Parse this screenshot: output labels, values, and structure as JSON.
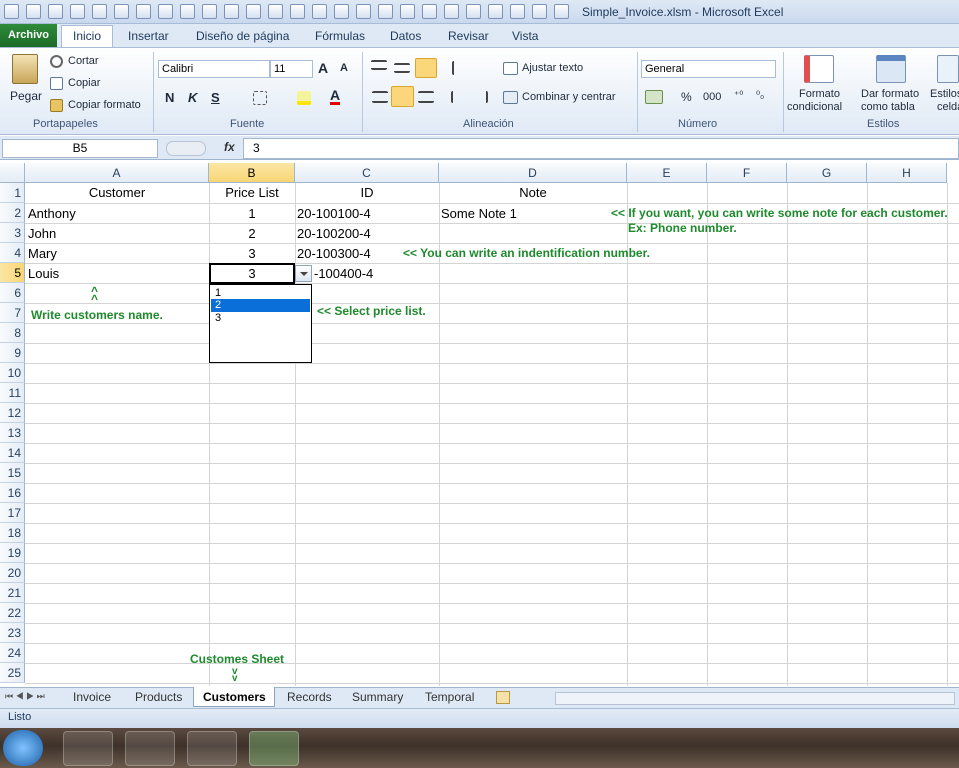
{
  "window": {
    "title": "Simple_Invoice.xlsm  -  Microsoft Excel"
  },
  "tabs": {
    "file": "Archivo",
    "items": [
      "Inicio",
      "Insertar",
      "Diseño de página",
      "Fórmulas",
      "Datos",
      "Revisar",
      "Vista"
    ]
  },
  "ribbon": {
    "clipboard": {
      "paste": "Pegar",
      "cut": "Cortar",
      "copy": "Copiar",
      "format_painter": "Copiar formato",
      "label": "Portapapeles"
    },
    "font": {
      "name": "Calibri",
      "size": "11",
      "bold": "N",
      "italic": "K",
      "underline": "S",
      "label": "Fuente"
    },
    "alignment": {
      "wrap": "Ajustar texto",
      "merge": "Combinar y centrar",
      "label": "Alineación"
    },
    "number": {
      "format": "General",
      "percent": "%",
      "thousands": "000",
      "label": "Número"
    },
    "styles": {
      "conditional_1": "Formato",
      "conditional_2": "condicional",
      "table_1": "Dar formato",
      "table_2": "como tabla",
      "cell_1": "Estilos",
      "cell_2": "celda",
      "label": "Estilos"
    }
  },
  "formula_bar": {
    "name_box": "B5",
    "fx": "fx",
    "value": "3"
  },
  "columns": [
    "A",
    "B",
    "C",
    "D",
    "E",
    "F",
    "G",
    "H"
  ],
  "rows": [
    "1",
    "2",
    "3",
    "4",
    "5",
    "6",
    "7",
    "8",
    "9",
    "10",
    "11",
    "12",
    "13",
    "14",
    "15",
    "16",
    "17",
    "18",
    "19",
    "20",
    "21",
    "22",
    "23",
    "24",
    "25"
  ],
  "cells": {
    "A1": "Customer",
    "B1": "Price List",
    "C1": "ID",
    "D1": "Note",
    "A2": "Anthony",
    "B2": "1",
    "C2": "20-100100-4",
    "D2": "Some Note 1",
    "A3": "John",
    "B3": "2",
    "C3": "20-100200-4",
    "A4": "Mary",
    "B4": "3",
    "C4": "20-100300-4",
    "A5": "Louis",
    "B5": "3",
    "C5": "-100400-4"
  },
  "notes": {
    "note_line1": "<< If you want, you can write some note for each customer.",
    "note_line2": "Ex: Phone number.",
    "id_note": "<< You can write an indentification number.",
    "arrow_up": "^",
    "customers_note": "Write customers name.",
    "price_note": "<< Select price list.",
    "sheet_note": "Customes Sheet",
    "arrow_down": "v"
  },
  "dropdown": {
    "options": [
      "1",
      "2",
      "3"
    ],
    "highlighted": "2"
  },
  "sheets": [
    "Invoice",
    "Products",
    "Customers",
    "Records",
    "Summary",
    "Temporal"
  ],
  "active_sheet": "Customers",
  "status": {
    "text": "Listo"
  },
  "colors": {
    "file_tab": "#1c6b27",
    "note_green": "#1e8a2c",
    "selection_header": "#f8d675",
    "dropdown_highlight": "#0a6fd8"
  }
}
